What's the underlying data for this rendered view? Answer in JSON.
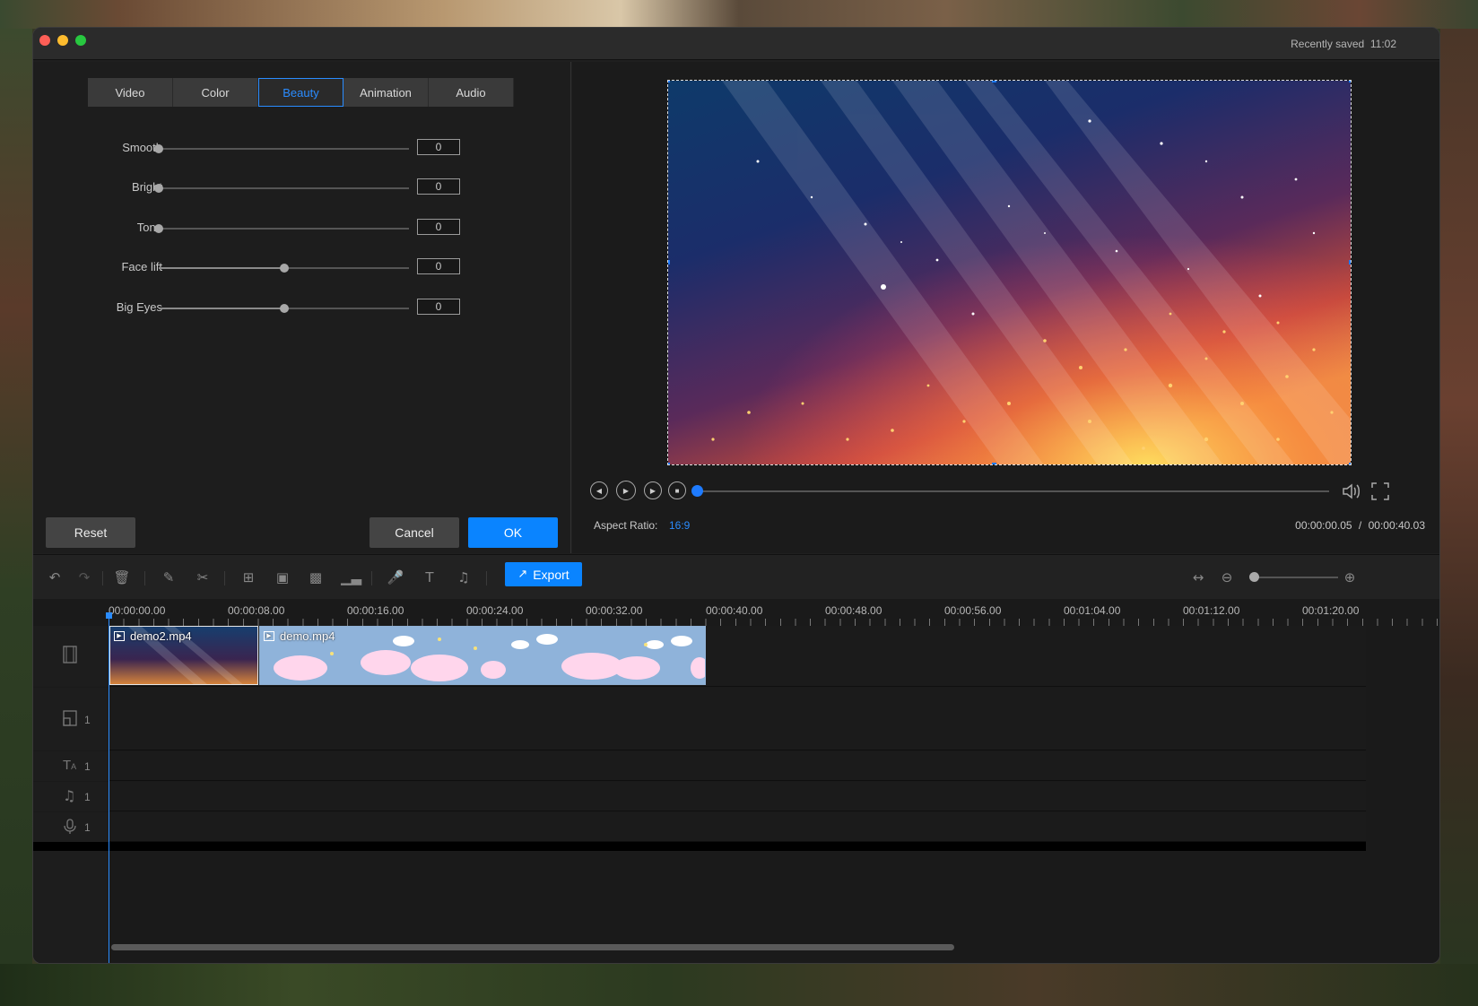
{
  "window": {
    "saved_label": "Recently saved",
    "saved_time": "11:02"
  },
  "tabs": [
    "Video",
    "Color",
    "Beauty",
    "Animation",
    "Audio"
  ],
  "active_tab": "Beauty",
  "sliders": [
    {
      "label": "Smooth",
      "value": "0",
      "fraction": 0.0
    },
    {
      "label": "Bright",
      "value": "0",
      "fraction": 0.0
    },
    {
      "label": "Tone",
      "value": "0",
      "fraction": 0.0
    },
    {
      "label": "Face lift",
      "value": "0",
      "fraction": 0.5
    },
    {
      "label": "Big Eyes",
      "value": "0",
      "fraction": 0.5
    }
  ],
  "buttons": {
    "reset": "Reset",
    "cancel": "Cancel",
    "ok": "OK"
  },
  "preview": {
    "aspect_label": "Aspect Ratio:",
    "aspect_value": "16:9",
    "current_time": "00:00:00.05",
    "separator": "/",
    "total_time": "00:00:40.03",
    "playback_fraction": 0.0
  },
  "toolbar": {
    "export_label": "Export"
  },
  "timeline": {
    "ticks": [
      "00:00:00.00",
      "00:00:08.00",
      "00:00:16.00",
      "00:00:24.00",
      "00:00:32.00",
      "00:00:40.00",
      "00:00:48.00",
      "00:00:56.00",
      "00:01:04.00",
      "00:01:12.00",
      "00:01:20.00"
    ],
    "clips": [
      {
        "name": "demo2.mp4"
      },
      {
        "name": "demo.mp4"
      }
    ],
    "tracks": [
      {
        "icon": "overlay-track-icon",
        "count": "1"
      },
      {
        "icon": "text-track-icon",
        "count": "1"
      },
      {
        "icon": "music-track-icon",
        "count": "1"
      },
      {
        "icon": "voice-track-icon",
        "count": "1"
      }
    ]
  },
  "colors": {
    "accent": "#0a84ff",
    "window_bg": "#1f1f1f"
  }
}
